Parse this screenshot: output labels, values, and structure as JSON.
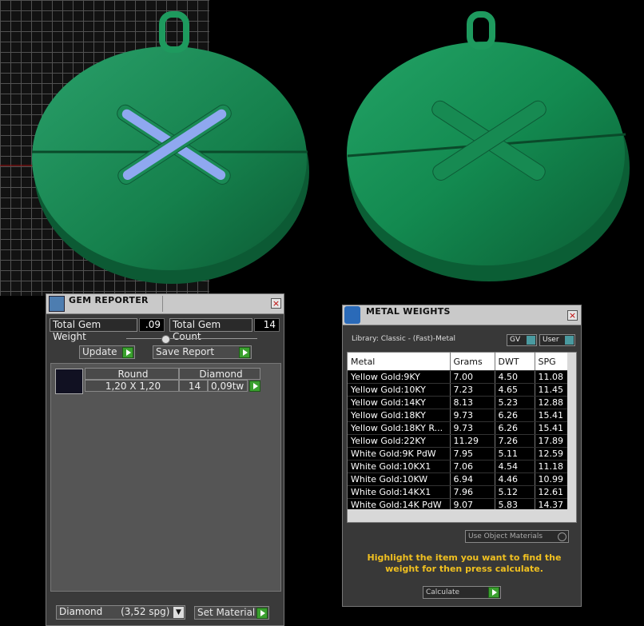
{
  "gem_reporter": {
    "title": "GEM REPORTER",
    "total_weight_label": "Total Gem Weight",
    "total_weight_value": ".09",
    "total_count_label": "Total Gem Count",
    "total_count_value": "14",
    "update_label": "Update",
    "save_report_label": "Save Report",
    "gem_row": {
      "shape": "Round",
      "material": "Diamond",
      "size": "1,20 X 1,20",
      "count": "14",
      "weight": "0,09tw"
    },
    "material_select": "Diamond      (3,52 spg)",
    "set_material_label": "Set Material"
  },
  "metal_weights": {
    "title": "METAL WEIGHTS",
    "library_label": "Library: Classic - (Fast)-Metal",
    "gv_label": "GV",
    "user_label": "User",
    "columns": [
      "Metal",
      "Grams",
      "DWT",
      "SPG"
    ],
    "rows": [
      [
        "Yellow Gold:9KY",
        "7.00",
        "4.50",
        "11.08"
      ],
      [
        "Yellow Gold:10KY",
        "7.23",
        "4.65",
        "11.45"
      ],
      [
        "Yellow Gold:14KY",
        "8.13",
        "5.23",
        "12.88"
      ],
      [
        "Yellow Gold:18KY",
        "9.73",
        "6.26",
        "15.41"
      ],
      [
        "Yellow Gold:18KY R...",
        "9.73",
        "6.26",
        "15.41"
      ],
      [
        "Yellow Gold:22KY",
        "11.29",
        "7.26",
        "17.89"
      ],
      [
        "White Gold:9K PdW",
        "7.95",
        "5.11",
        "12.59"
      ],
      [
        "White Gold:10KX1",
        "7.06",
        "4.54",
        "11.18"
      ],
      [
        "White Gold:10KW",
        "6.94",
        "4.46",
        "10.99"
      ],
      [
        "White Gold:14KX1",
        "7.96",
        "5.12",
        "12.61"
      ],
      [
        "White Gold:14K PdW",
        "9.07",
        "5.83",
        "14.37"
      ]
    ],
    "use_object_materials_label": "Use Object Materials",
    "hint": "Highlight the item you want to find the weight for then press calculate.",
    "calculate_label": "Calculate"
  },
  "colors": {
    "metal": "#1f8f5a",
    "gem": "#8fa8f0",
    "hint": "#f0c020",
    "button_green": "#3aa02e"
  }
}
